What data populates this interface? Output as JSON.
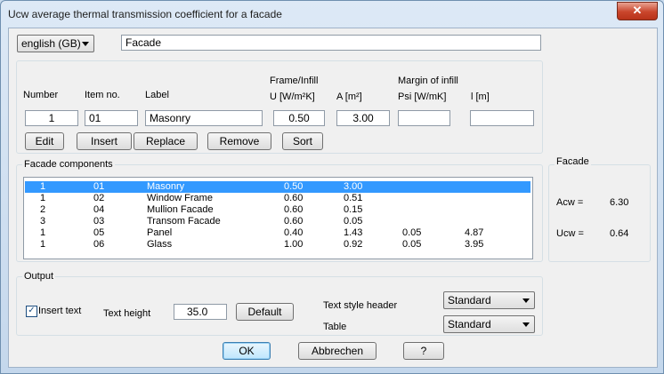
{
  "window": {
    "title": "Ucw average thermal transmission coefficient for a facade",
    "close_glyph": "✕"
  },
  "top": {
    "language": "english (GB)",
    "name_value": "Facade"
  },
  "headers": {
    "number": "Number",
    "item_no": "Item no.",
    "label": "Label",
    "frame_infill": "Frame/Infill",
    "u": "U [W/m²K]",
    "a": "A [m²]",
    "margin_infill": "Margin of infill",
    "psi": "Psi [W/mK]",
    "l": "l [m]"
  },
  "inputs": {
    "number": "1",
    "item_no": "01",
    "label": "Masonry",
    "u": "0.50",
    "a": "3.00",
    "psi": "",
    "l": ""
  },
  "buttons": {
    "edit": "Edit",
    "insert": "Insert",
    "replace": "Replace",
    "remove": "Remove",
    "sort": "Sort"
  },
  "components": {
    "title": "Facade components",
    "rows": [
      {
        "n": "1",
        "item": "01",
        "label": "Masonry",
        "u": "0.50",
        "a": "3.00",
        "psi": "",
        "l": ""
      },
      {
        "n": "1",
        "item": "02",
        "label": "Window Frame",
        "u": "0.60",
        "a": "0.51",
        "psi": "",
        "l": ""
      },
      {
        "n": "2",
        "item": "04",
        "label": "Mullion Facade",
        "u": "0.60",
        "a": "0.15",
        "psi": "",
        "l": ""
      },
      {
        "n": "3",
        "item": "03",
        "label": "Transom Facade",
        "u": "0.60",
        "a": "0.05",
        "psi": "",
        "l": ""
      },
      {
        "n": "1",
        "item": "05",
        "label": "Panel",
        "u": "0.40",
        "a": "1.43",
        "psi": "0.05",
        "l": "4.87"
      },
      {
        "n": "1",
        "item": "06",
        "label": "Glass",
        "u": "1.00",
        "a": "0.92",
        "psi": "0.05",
        "l": "3.95"
      }
    ],
    "selected_index": 0
  },
  "facade_summary": {
    "title": "Facade",
    "acw_label": "Acw =",
    "acw_value": "6.30",
    "ucw_label": "Ucw =",
    "ucw_value": "0.64"
  },
  "output": {
    "title": "Output",
    "insert_text_label": "Insert text",
    "insert_text_checked": true,
    "check_glyph": "✓",
    "text_height_label": "Text height",
    "text_height_value": "35.0",
    "default_button": "Default",
    "text_style_header_label": "Text style header",
    "text_style_header_value": "Standard",
    "table_label": "Table",
    "table_value": "Standard"
  },
  "footer": {
    "ok": "OK",
    "cancel": "Abbrechen",
    "help": "?"
  }
}
